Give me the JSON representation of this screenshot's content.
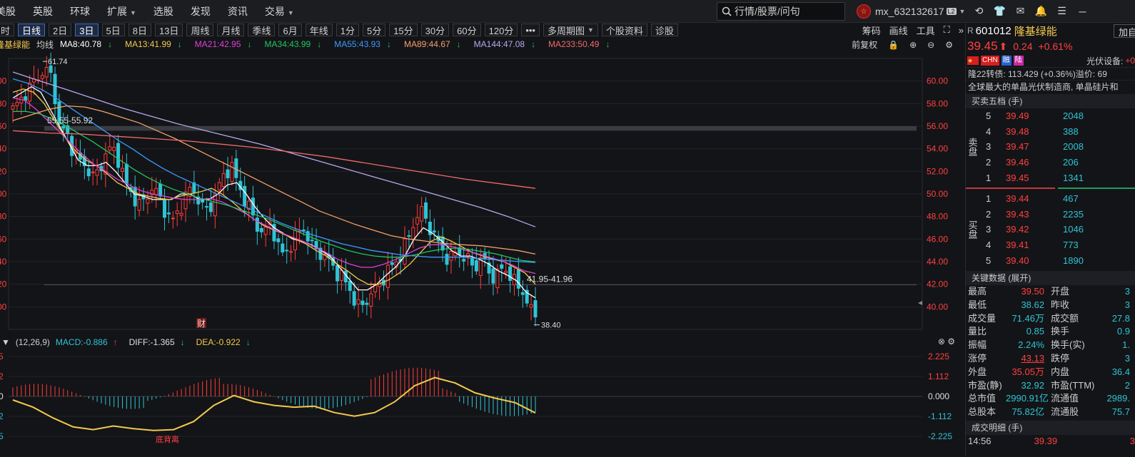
{
  "menu": {
    "items": [
      {
        "label": "美股",
        "caret": false
      },
      {
        "label": "英股",
        "caret": false
      },
      {
        "label": "环球",
        "caret": false
      },
      {
        "label": "扩展",
        "caret": true
      },
      {
        "label": "选股",
        "caret": false
      },
      {
        "label": "发现",
        "caret": false
      },
      {
        "label": "资讯",
        "caret": false
      },
      {
        "label": "交易",
        "caret": true
      }
    ],
    "search_placeholder": "行情/股票/问句",
    "username": "mx_632132617",
    "level_badge": "L2"
  },
  "periods": [
    "时",
    "日线",
    "2日",
    "3日",
    "5日",
    "8日",
    "13日",
    "周线",
    "月线",
    "季线",
    "6月",
    "年线",
    "1分",
    "5分",
    "15分",
    "30分",
    "60分",
    "120分",
    "•••",
    "多周期图",
    "个股资料",
    "诊股"
  ],
  "active_periods": [
    "日线",
    "3日"
  ],
  "toolbar_right": [
    "筹码",
    "画线",
    "工具",
    "⛶",
    "»"
  ],
  "ma_legend": {
    "name": "隆基绿能",
    "label": "均线",
    "items": [
      {
        "text": "MA8:40.78",
        "arrow": "↓",
        "color": "#ffffff"
      },
      {
        "text": "MA13:41.99",
        "arrow": "↓",
        "color": "#f2c94c"
      },
      {
        "text": "MA21:42.95",
        "arrow": "↓",
        "color": "#e040d8"
      },
      {
        "text": "MA34:43.99",
        "arrow": "↓",
        "color": "#22c55e"
      },
      {
        "text": "MA55:43.93",
        "arrow": "↓",
        "color": "#3b9bff"
      },
      {
        "text": "MA89:44.67",
        "arrow": "↓",
        "color": "#f5a06a"
      },
      {
        "text": "MA144:47.08",
        "arrow": "↓",
        "color": "#b6a8f0"
      },
      {
        "text": "MA233:50.49",
        "arrow": "↓",
        "color": "#f06a6a"
      }
    ],
    "fq": "前复权"
  },
  "chart_data": [
    {
      "type": "candlestick",
      "title": "",
      "y_ticks": [
        40.0,
        42.0,
        44.0,
        46.0,
        48.0,
        50.0,
        52.0,
        54.0,
        56.0,
        58.0,
        60.0
      ],
      "ylim": [
        38.0,
        62.0
      ],
      "annotations": {
        "high": "61.74",
        "low": "38.40",
        "band_top": "55.55-55.92",
        "band_bottom": "41.95-41.96",
        "event_marker": "财"
      },
      "close_path": [
        57.5,
        58.2,
        59.0,
        59.8,
        60.5,
        61.0,
        60.2,
        56.0,
        55.5,
        54.0,
        53.0,
        52.5,
        51.5,
        52.0,
        53.5,
        54.2,
        53.0,
        51.0,
        50.0,
        49.0,
        49.5,
        50.5,
        50.0,
        48.5,
        47.5,
        48.5,
        49.5,
        50.8,
        49.5,
        48.5,
        49.0,
        50.5,
        51.8,
        52.5,
        51.0,
        49.5,
        48.5,
        47.0,
        46.5,
        47.5,
        45.5,
        44.5,
        45.5,
        46.5,
        47.0,
        45.5,
        45.0,
        44.5,
        44.0,
        43.0,
        42.5,
        41.5,
        40.0,
        40.2,
        41.0,
        41.8,
        42.5,
        43.5,
        44.0,
        45.0,
        46.5,
        48.0,
        48.5,
        47.0,
        46.0,
        45.0,
        44.0,
        45.0,
        44.5,
        44.0,
        43.5,
        44.5,
        43.0,
        42.5,
        43.5,
        43.0,
        42.0,
        41.5,
        40.0,
        39.2
      ],
      "ma_series": [
        {
          "color": "#ffffff",
          "values": [
            58.5,
            59.0,
            59.5,
            59.0,
            57.5,
            56.0,
            54.5,
            53.0,
            52.5,
            52.5,
            52.8,
            52.0,
            51.0,
            50.0,
            49.8,
            49.5,
            49.5,
            49.5,
            50.0,
            50.0,
            49.5,
            49.5,
            50.0,
            50.8,
            51.0,
            50.0,
            48.8,
            47.8,
            47.0,
            46.5,
            46.0,
            45.8,
            45.5,
            45.0,
            44.5,
            43.5,
            42.5,
            41.5,
            41.5,
            42.0,
            42.8,
            43.5,
            44.5,
            46.0,
            47.0,
            46.5,
            45.8,
            45.0,
            44.5,
            44.5,
            44.2,
            43.8,
            43.2,
            42.8,
            42.3,
            41.3,
            40.8
          ]
        },
        {
          "color": "#f2c94c",
          "values": [
            59.0,
            59.3,
            59.0,
            58.0,
            56.5,
            55.0,
            53.8,
            53.0,
            52.5,
            51.8,
            51.0,
            50.5,
            50.0,
            49.8,
            49.6,
            49.5,
            49.8,
            50.0,
            50.2,
            50.5,
            50.0,
            49.3,
            48.5,
            47.8,
            47.2,
            46.8,
            46.4,
            46.0,
            45.6,
            45.0,
            44.5,
            43.8,
            43.2,
            42.5,
            42.0,
            42.0,
            42.4,
            43.0,
            43.8,
            44.8,
            45.8,
            46.2,
            45.8,
            45.3,
            44.8,
            44.5,
            44.2,
            44.0,
            43.5,
            43.0,
            42.0
          ]
        },
        {
          "color": "#e040d8",
          "values": [
            58.5,
            58.3,
            57.5,
            56.5,
            55.5,
            54.5,
            53.5,
            52.6,
            52.0,
            51.3,
            50.8,
            50.3,
            50.0,
            49.8,
            49.6,
            49.5,
            49.5,
            49.6,
            49.3,
            48.8,
            48.3,
            47.6,
            47.1,
            46.6,
            46.2,
            45.8,
            45.3,
            44.8,
            44.2,
            43.8,
            43.5,
            43.5,
            43.8,
            44.2,
            44.7,
            45.2,
            45.5,
            45.5,
            45.3,
            45.0,
            44.7,
            44.4,
            44.1,
            43.7,
            43.2,
            42.95
          ]
        },
        {
          "color": "#22c55e",
          "values": [
            57.3,
            57.3,
            57.1,
            56.6,
            56.0,
            55.3,
            54.6,
            53.8,
            53.0,
            52.2,
            51.5,
            50.9,
            50.4,
            50.0,
            49.6,
            49.3,
            49.0,
            48.6,
            48.2,
            47.8,
            47.3,
            46.8,
            46.3,
            45.8,
            45.4,
            45.0,
            44.7,
            44.5,
            44.4,
            44.4,
            44.6,
            44.9,
            45.1,
            45.2,
            45.1,
            44.9,
            44.7,
            44.4,
            44.1,
            43.99
          ]
        },
        {
          "color": "#3b9bff",
          "values": [
            60.2,
            59.8,
            59.2,
            58.4,
            57.5,
            56.6,
            55.7,
            54.8,
            54.0,
            53.1,
            52.3,
            51.6,
            51.0,
            50.4,
            49.8,
            49.2,
            48.6,
            48.0,
            47.4,
            46.9,
            46.4,
            46.0,
            45.6,
            45.3,
            45.0,
            44.8,
            44.6,
            44.5,
            44.4,
            44.4,
            44.4,
            44.3,
            44.2,
            44.1,
            44.0,
            43.93
          ]
        },
        {
          "color": "#f5a06a",
          "values": [
            56.5,
            57.0,
            57.5,
            57.8,
            57.7,
            57.3,
            56.8,
            56.3,
            55.6,
            54.9,
            54.1,
            53.3,
            52.5,
            51.7,
            50.9,
            50.1,
            49.3,
            48.5,
            47.9,
            47.3,
            46.8,
            46.3,
            46.0,
            45.8,
            45.6,
            45.5,
            45.4,
            45.2,
            45.0,
            44.67
          ]
        },
        {
          "color": "#b6a8f0",
          "values": [
            60.8,
            60.0,
            59.2,
            58.4,
            57.6,
            56.9,
            56.2,
            55.6,
            55.0,
            54.4,
            53.7,
            53.0,
            52.3,
            51.6,
            50.9,
            50.2,
            49.5,
            48.8,
            48.0,
            47.08
          ]
        },
        {
          "color": "#f06a6a",
          "values": [
            55.6,
            55.4,
            55.3,
            55.1,
            54.9,
            54.7,
            54.4,
            54.1,
            53.7,
            53.3,
            52.8,
            52.3,
            51.8,
            51.3,
            50.9,
            50.49
          ]
        }
      ]
    },
    {
      "type": "bar",
      "title": "MACD",
      "y_ticks": [
        2.225,
        1.112,
        0.0,
        -1.112,
        -2.225
      ],
      "ylim": [
        -2.225,
        2.225
      ],
      "dea_path": [
        -0.2,
        -0.6,
        -1.2,
        -1.7,
        -1.85,
        -1.65,
        -1.8,
        -1.9,
        -1.85,
        -1.4,
        -0.5,
        0.05,
        -0.3,
        -0.5,
        -0.6,
        -0.55,
        -0.9,
        -1.1,
        -0.9,
        -0.3,
        0.6,
        1.05,
        0.75,
        0.2,
        -0.1,
        -0.35,
        -0.922
      ]
    }
  ],
  "macd_legend": {
    "params": "(12,26,9)",
    "items": [
      {
        "text": "MACD:-0.886",
        "arrow": "↑",
        "color": "#2ec4d6"
      },
      {
        "text": "DIFF:-1.365",
        "arrow": "↓",
        "color": "#e0e0e0"
      },
      {
        "text": "DEA:-0.922",
        "arrow": "↓",
        "color": "#f2c94c"
      }
    ],
    "divergence": "底背离"
  },
  "stock": {
    "prefix": "R",
    "code": "601012",
    "name": "隆基绿能",
    "add_label": "加自",
    "price": "39.45",
    "change": "0.24",
    "change_pct": "+0.61%",
    "tags": [
      {
        "text": "CHN",
        "color": "#d61f1f"
      },
      {
        "text": "融",
        "color": "#2a5fcf"
      },
      {
        "text": "陆",
        "color": "#c52aa0"
      }
    ],
    "industry": "光伏设备:",
    "industry_value": "+0",
    "bond_line": "隆22转债: 113.429 (+0.36%)溢价: 69",
    "desc": "全球最大的单晶光伏制造商, 单晶硅片和"
  },
  "orderbook": {
    "title": "买卖五档 (手)",
    "ask_label": "卖盘",
    "bid_label": "买盘",
    "asks": [
      {
        "lv": "5",
        "price": "39.49",
        "vol": "2048"
      },
      {
        "lv": "4",
        "price": "39.48",
        "vol": "388"
      },
      {
        "lv": "3",
        "price": "39.47",
        "vol": "2008"
      },
      {
        "lv": "2",
        "price": "39.46",
        "vol": "206"
      },
      {
        "lv": "1",
        "price": "39.45",
        "vol": "1341"
      }
    ],
    "bids": [
      {
        "lv": "1",
        "price": "39.44",
        "vol": "467"
      },
      {
        "lv": "2",
        "price": "39.43",
        "vol": "2235"
      },
      {
        "lv": "3",
        "price": "39.42",
        "vol": "1046"
      },
      {
        "lv": "4",
        "price": "39.41",
        "vol": "773"
      },
      {
        "lv": "5",
        "price": "39.40",
        "vol": "1890"
      }
    ]
  },
  "keydata": {
    "title": "关键数据 (展开)",
    "rows": [
      {
        "l1": "最高",
        "v1": "39.50",
        "c1": "red",
        "l2": "开盘",
        "v2": "3"
      },
      {
        "l1": "最低",
        "v1": "38.62",
        "c1": "cyan",
        "l2": "昨收",
        "v2": "3"
      },
      {
        "l1": "成交量",
        "v1": "71.46万",
        "c1": "cyan",
        "l2": "成交额",
        "v2": "27.8"
      },
      {
        "l1": "量比",
        "v1": "0.85",
        "c1": "cyan",
        "l2": "换手",
        "v2": "0.9"
      },
      {
        "l1": "振幅",
        "v1": "2.24%",
        "c1": "cyan",
        "l2": "换手(实)",
        "v2": "1."
      },
      {
        "l1": "涨停",
        "v1": "43.13",
        "c1": "red",
        "l2": "跌停",
        "v2": "3"
      },
      {
        "l1": "外盘",
        "v1": "35.05万",
        "c1": "red",
        "l2": "内盘",
        "v2": "36.4"
      },
      {
        "l1": "市盈(静)",
        "v1": "32.92",
        "c1": "cyan",
        "l2": "市盈(TTM)",
        "v2": "2"
      },
      {
        "l1": "总市值",
        "v1": "2990.91亿",
        "c1": "cyan",
        "l2": "流通值",
        "v2": "2989."
      },
      {
        "l1": "总股本",
        "v1": "75.82亿",
        "c1": "cyan",
        "l2": "流通股",
        "v2": "75.7"
      }
    ]
  },
  "trades": {
    "title": "成交明细 (手)",
    "first": {
      "time": "14:56",
      "price": "39.39",
      "vol": "3"
    }
  }
}
